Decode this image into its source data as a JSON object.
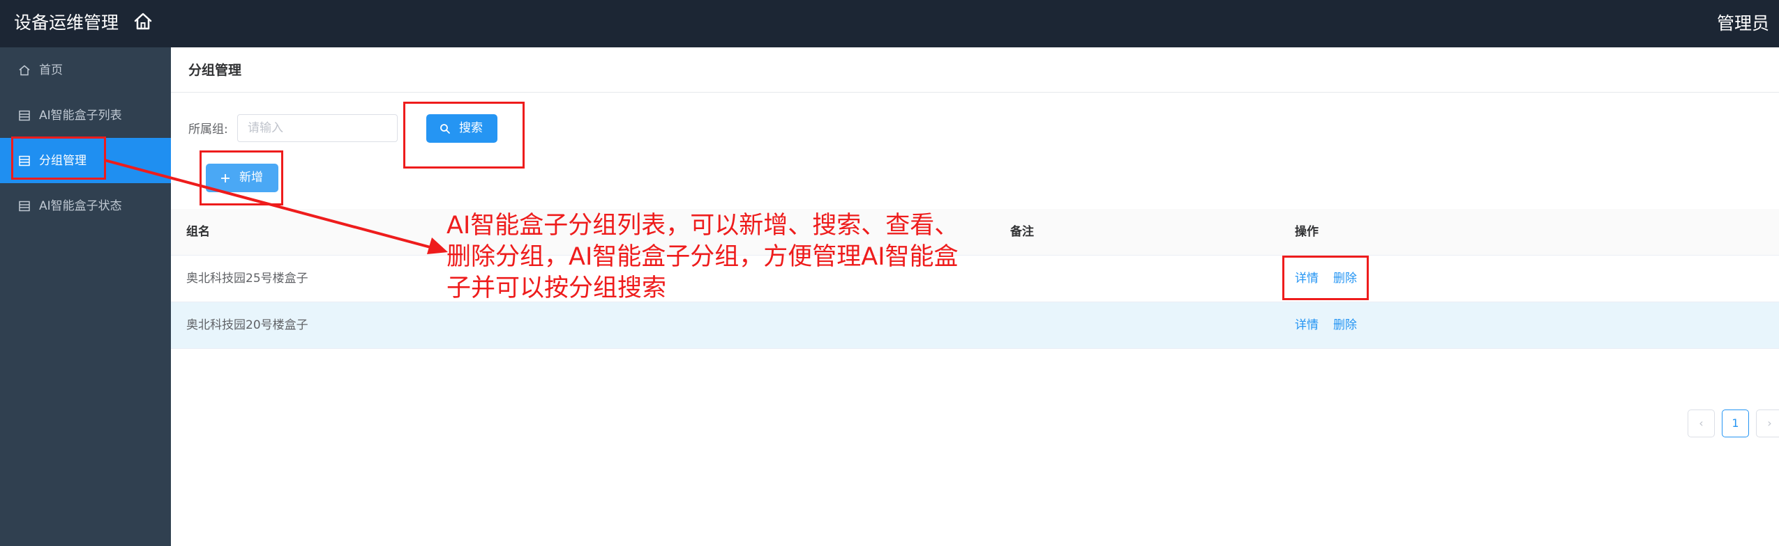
{
  "header": {
    "app_title": "设备运维管理",
    "home_icon": "home-icon",
    "user_name": "管理员"
  },
  "sidebar": {
    "items": [
      {
        "label": "首页",
        "icon": "home-icon",
        "active": false
      },
      {
        "label": "AI智能盒子列表",
        "icon": "table-icon",
        "active": false
      },
      {
        "label": "分组管理",
        "icon": "table-icon",
        "active": true
      },
      {
        "label": "AI智能盒子状态",
        "icon": "table-icon",
        "active": false
      }
    ]
  },
  "main": {
    "page_title": "分组管理",
    "filter": {
      "label": "所属组:",
      "placeholder": "请输入",
      "value": ""
    },
    "search_button": "搜索",
    "add_button": "新增",
    "table": {
      "columns": [
        "组名",
        "备注",
        "操作"
      ],
      "rows": [
        {
          "name": "奥北科技园25号楼盒子",
          "remark": "",
          "actions": [
            "详情",
            "删除"
          ]
        },
        {
          "name": "奥北科技园20号楼盒子",
          "remark": "",
          "actions": [
            "详情",
            "删除"
          ]
        }
      ]
    },
    "pagination": {
      "prev": "‹",
      "current_page": "1",
      "next": "›"
    }
  },
  "annotation": {
    "text": "AI智能盒子分组列表，可以新增、搜索、查看、删除分组，AI智能盒子分组，方便管理AI智能盒子并可以按分组搜索",
    "color": "#ee1c1c"
  },
  "colors": {
    "topbar": "#1c2634",
    "sidebar": "#304050",
    "active": "#1f8ff1",
    "primary": "#2595f3",
    "row_highlight": "#e8f5fc"
  }
}
